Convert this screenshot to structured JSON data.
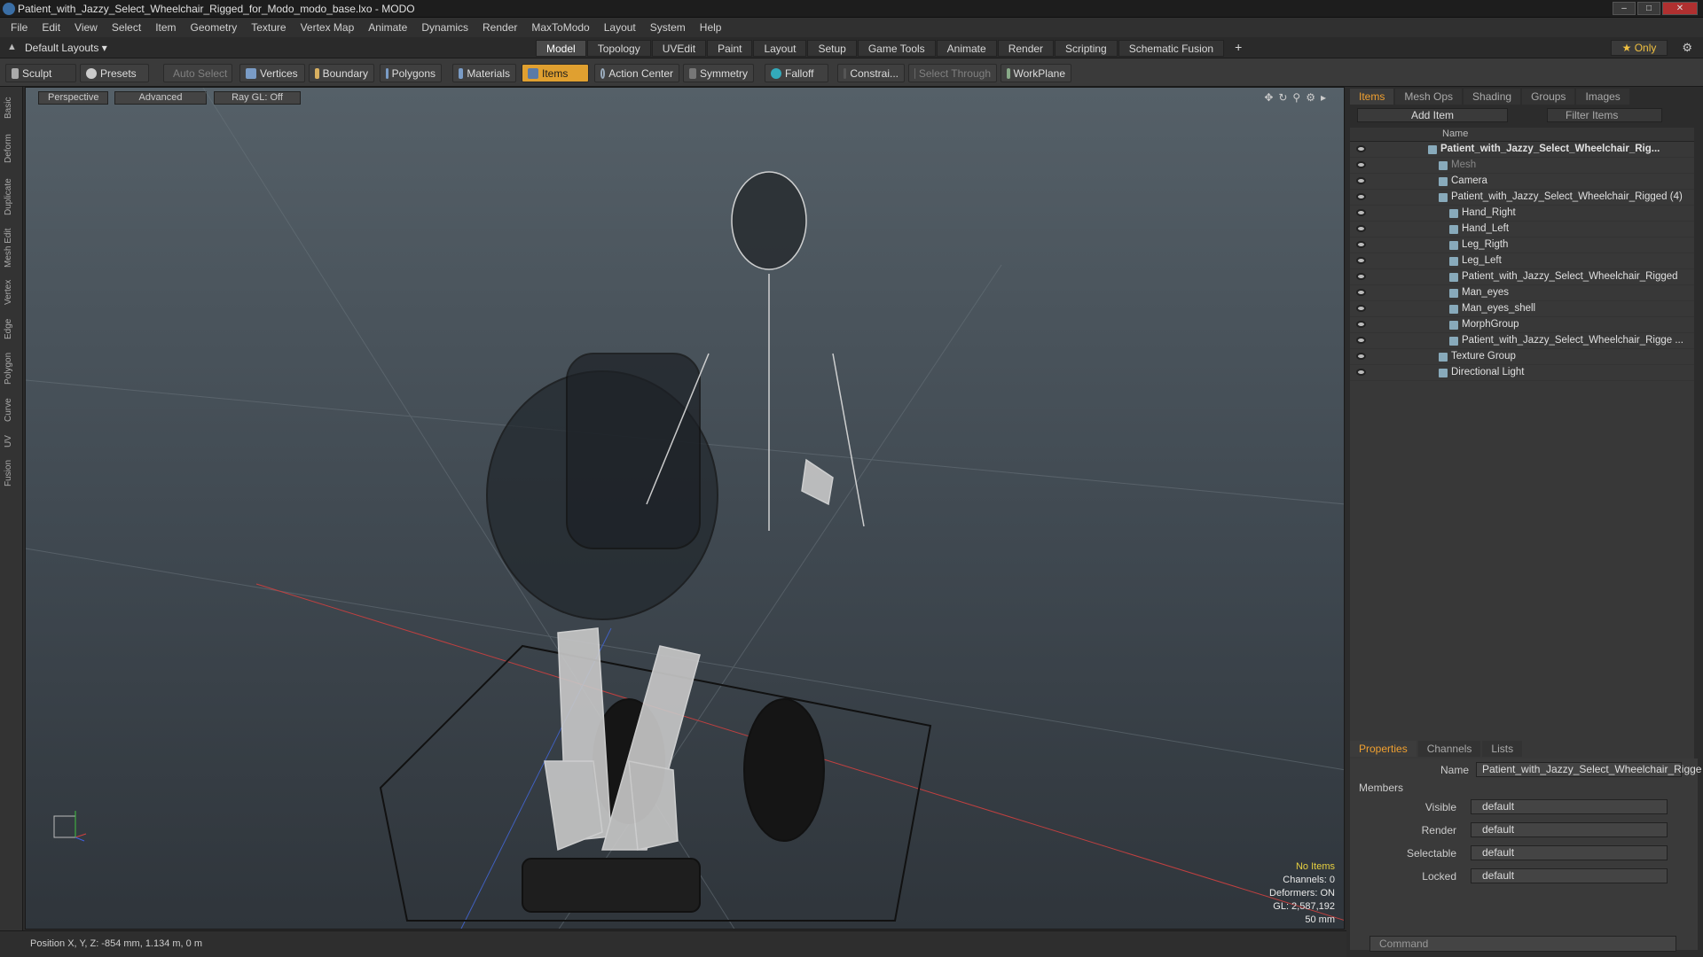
{
  "window": {
    "title": "Patient_with_Jazzy_Select_Wheelchair_Rigged_for_Modo_modo_base.lxo - MODO",
    "min": "–",
    "max": "□",
    "close": "✕"
  },
  "menu": [
    "File",
    "Edit",
    "View",
    "Select",
    "Item",
    "Geometry",
    "Texture",
    "Vertex Map",
    "Animate",
    "Dynamics",
    "Render",
    "MaxToModo",
    "Layout",
    "System",
    "Help"
  ],
  "layouts": {
    "label": "Default Layouts ▾",
    "tabs": [
      "Model",
      "Topology",
      "UVEdit",
      "Paint",
      "Layout",
      "Setup",
      "Game Tools",
      "Animate",
      "Render",
      "Scripting",
      "Schematic Fusion"
    ],
    "active": "Model",
    "add": "+",
    "only": "★ Only"
  },
  "toolbar": {
    "sculpt": "Sculpt",
    "presets": "Presets",
    "auto_select": "Auto Select",
    "vertices": "Vertices",
    "boundary": "Boundary",
    "polygons": "Polygons",
    "materials": "Materials",
    "items": "Items",
    "action_center": "Action Center",
    "symmetry": "Symmetry",
    "falloff": "Falloff",
    "constrain": "Constrai...",
    "select_through": "Select Through",
    "workplane": "WorkPlane"
  },
  "left_tabs": [
    "Basic",
    "Deform",
    "Duplicate",
    "Mesh Edit",
    "Vertex",
    "Edge",
    "Polygon",
    "Curve",
    "UV",
    "Fusion"
  ],
  "viewport": {
    "perspective": "Perspective",
    "advanced": "Advanced",
    "raygl": "Ray GL: Off"
  },
  "stats": {
    "no_items": "No Items",
    "channels": "Channels: 0",
    "deformers": "Deformers: ON",
    "gl": "GL: 2,587,192",
    "lens": "50 mm"
  },
  "status": {
    "position": "Position X, Y, Z:  -854 mm, 1.134 m, 0 m"
  },
  "panel": {
    "tabs": [
      "Items",
      "Mesh Ops",
      "Shading",
      "Groups",
      "Images"
    ],
    "add_item": "Add Item",
    "filter": "Filter Items",
    "col_name": "Name",
    "tree": [
      {
        "label": "Patient_with_Jazzy_Select_Wheelchair_Rig...",
        "depth": 0,
        "bold": true
      },
      {
        "label": "Mesh",
        "depth": 1,
        "dim": true
      },
      {
        "label": "Camera",
        "depth": 1
      },
      {
        "label": "Patient_with_Jazzy_Select_Wheelchair_Rigged (4)",
        "depth": 1
      },
      {
        "label": "Hand_Right",
        "depth": 2
      },
      {
        "label": "Hand_Left",
        "depth": 2
      },
      {
        "label": "Leg_Rigth",
        "depth": 2
      },
      {
        "label": "Leg_Left",
        "depth": 2
      },
      {
        "label": "Patient_with_Jazzy_Select_Wheelchair_Rigged",
        "depth": 2
      },
      {
        "label": "Man_eyes",
        "depth": 2
      },
      {
        "label": "Man_eyes_shell",
        "depth": 2
      },
      {
        "label": "MorphGroup",
        "depth": 2
      },
      {
        "label": "Patient_with_Jazzy_Select_Wheelchair_Rigge ...",
        "depth": 2
      },
      {
        "label": "Texture Group",
        "depth": 1
      },
      {
        "label": "Directional Light",
        "depth": 1
      }
    ],
    "prop_tabs": [
      "Properties",
      "Channels",
      "Lists"
    ],
    "name_label": "Name",
    "name_value": "Patient_with_Jazzy_Select_Wheelchair_Rigge",
    "members": "Members",
    "fields": [
      {
        "label": "Visible",
        "value": "default"
      },
      {
        "label": "Render",
        "value": "default"
      },
      {
        "label": "Selectable",
        "value": "default"
      },
      {
        "label": "Locked",
        "value": "default"
      }
    ],
    "command_placeholder": "Command"
  },
  "colors": {
    "accent": "#e0a030",
    "viewport_top": "#556068",
    "viewport_bottom": "#2f353b"
  }
}
